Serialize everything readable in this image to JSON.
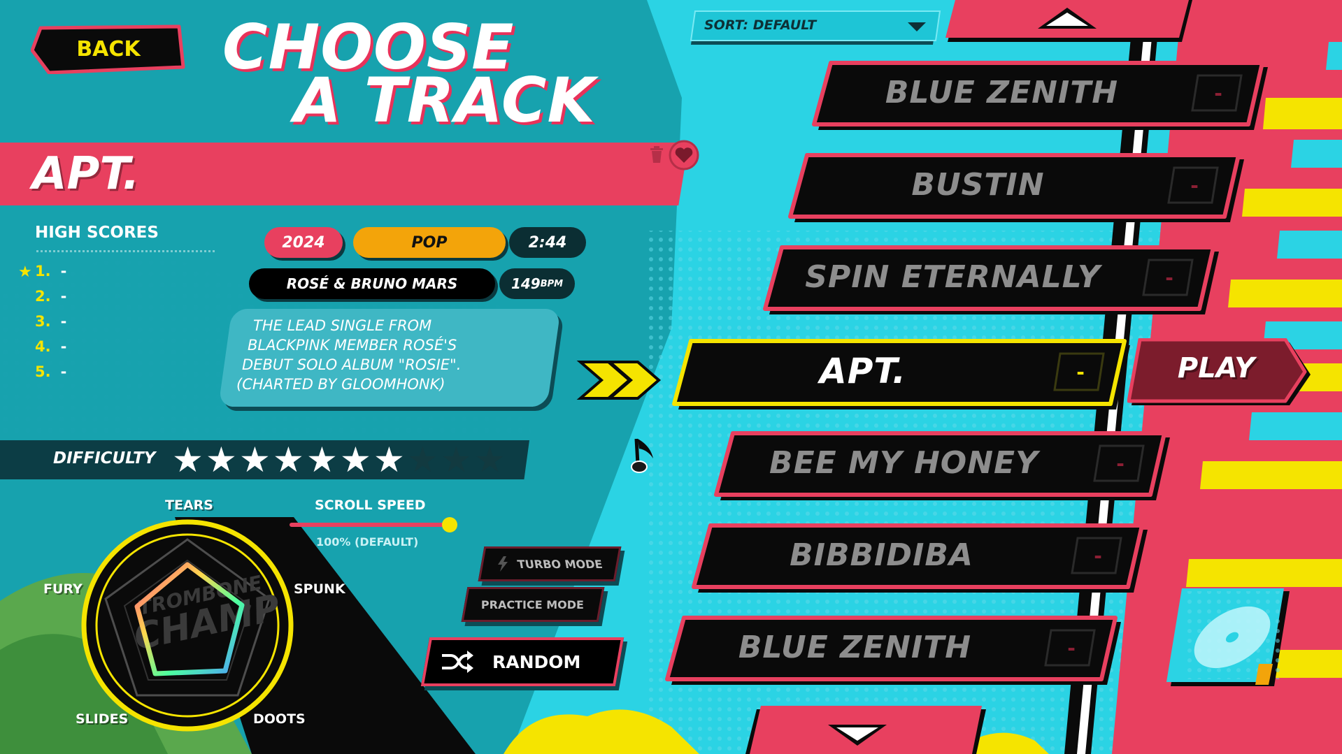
{
  "header": {
    "back_label": "BACK",
    "title_line1": "CHOOSE",
    "title_line2": "A TRACK"
  },
  "sort": {
    "label": "SORT: DEFAULT"
  },
  "song": {
    "title": "APT.",
    "year": "2024",
    "genre": "POP",
    "length": "2:44",
    "artist": "ROSÉ & BRUNO MARS",
    "bpm": "149",
    "bpm_unit": "BPM",
    "description": "THE LEAD SINGLE FROM BLACKPINK MEMBER ROSÉ'S DEBUT SOLO ALBUM \"ROSIE\". (CHARTED BY GLOOMHONK)",
    "description_lines": [
      "THE LEAD SINGLE FROM",
      "BLACKPINK MEMBER ROSÉ'S",
      "DEBUT SOLO ALBUM \"ROSIE\".",
      "(CHARTED BY GLOOMHONK)"
    ]
  },
  "high_scores": {
    "title": "HIGH SCORES",
    "rows": [
      {
        "rank": "1.",
        "score": "-"
      },
      {
        "rank": "2.",
        "score": "-"
      },
      {
        "rank": "3.",
        "score": "-"
      },
      {
        "rank": "4.",
        "score": "-"
      },
      {
        "rank": "5.",
        "score": "-"
      }
    ]
  },
  "difficulty": {
    "label": "DIFFICULTY",
    "value": 7,
    "max": 10
  },
  "radar": {
    "labels": {
      "top": "TEARS",
      "right": "SPUNK",
      "bottom_right": "DOOTS",
      "bottom_left": "SLIDES",
      "left": "FURY"
    },
    "logo_text": "TROMBONE CHAMP"
  },
  "scroll_speed": {
    "label": "SCROLL SPEED",
    "value_text": "100% (DEFAULT)",
    "value": 1.0
  },
  "modes": {
    "turbo": "TURBO MODE",
    "practice": "PRACTICE MODE",
    "random": "RANDOM"
  },
  "track_list": [
    {
      "title": "BLUE ZENITH",
      "score": "-"
    },
    {
      "title": "BUSTIN",
      "score": "-"
    },
    {
      "title": "SPIN ETERNALLY",
      "score": "-"
    },
    {
      "title": "APT.",
      "score": "-",
      "selected": true
    },
    {
      "title": "BEE MY HONEY",
      "score": "-"
    },
    {
      "title": "BIBBIDIBA",
      "score": "-"
    },
    {
      "title": "BLUE ZENITH",
      "score": "-"
    }
  ],
  "play_label": "PLAY",
  "icons": {
    "trash": "trash-icon",
    "favorite": "heart-icon",
    "random": "shuffle-icon",
    "turbo": "lightning-icon",
    "scroll_up": "triangle-up-icon",
    "scroll_down": "triangle-down-icon",
    "sort_dropdown": "chevron-down-icon",
    "cursor": "music-note-icon"
  },
  "colors": {
    "accent_pink": "#e8405f",
    "accent_yellow": "#f5e400",
    "teal": "#17a2ae",
    "cyan": "#29d4e6",
    "orange": "#f3a40a"
  }
}
